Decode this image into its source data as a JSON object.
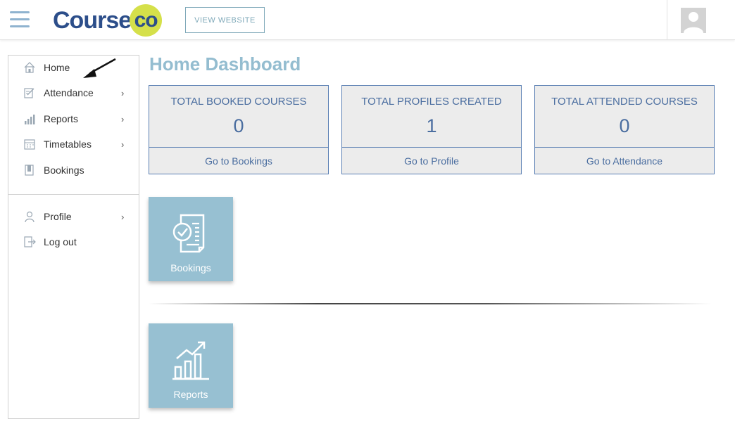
{
  "header": {
    "logo_text": "Course",
    "logo_badge": "co",
    "view_website_label": "VIEW WEBSITE"
  },
  "sidebar": {
    "items": [
      {
        "label": "Home",
        "icon": "home-icon",
        "chevron": ""
      },
      {
        "label": "Attendance",
        "icon": "attendance-icon",
        "chevron": "›"
      },
      {
        "label": "Reports",
        "icon": "reports-icon",
        "chevron": "›"
      },
      {
        "label": "Timetables",
        "icon": "timetables-icon",
        "chevron": "›"
      },
      {
        "label": "Bookings",
        "icon": "bookings-icon",
        "chevron": ""
      }
    ],
    "account_items": [
      {
        "label": "Profile",
        "icon": "profile-icon",
        "chevron": "›"
      },
      {
        "label": "Log out",
        "icon": "logout-icon",
        "chevron": ""
      }
    ]
  },
  "main": {
    "title": "Home Dashboard",
    "stats": [
      {
        "title": "TOTAL BOOKED COURSES",
        "value": "0",
        "link": "Go to Bookings"
      },
      {
        "title": "TOTAL PROFILES CREATED",
        "value": "1",
        "link": "Go to Profile"
      },
      {
        "title": "TOTAL ATTENDED COURSES",
        "value": "0",
        "link": "Go to Attendance"
      }
    ],
    "tiles": [
      {
        "label": "Bookings",
        "icon": "bookings-document-icon"
      },
      {
        "label": "Reports",
        "icon": "reports-chart-icon"
      }
    ]
  },
  "colors": {
    "brand_navy": "#2c4e8a",
    "brand_lime": "#d5e04a",
    "accent_light_blue": "#94bdd0",
    "tile_blue": "#97c0d2",
    "stat_text": "#4b6ea0"
  }
}
